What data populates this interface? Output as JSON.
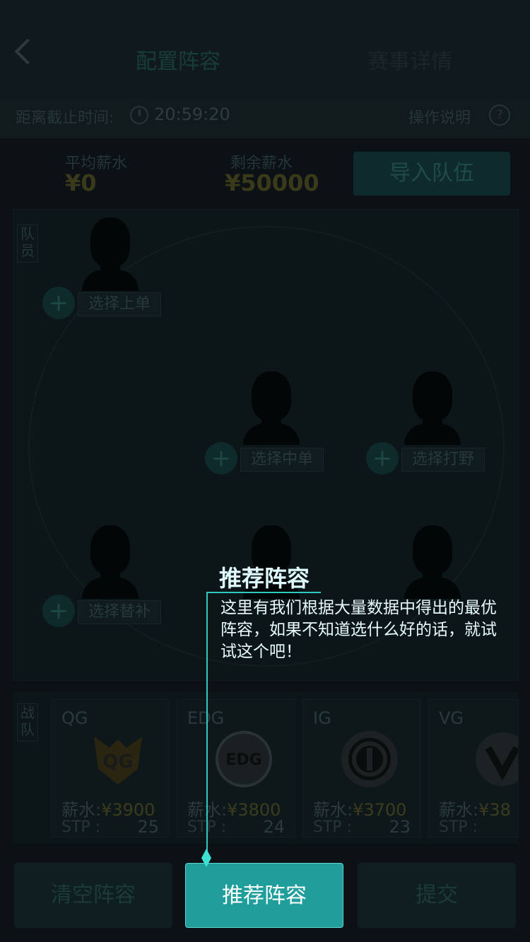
{
  "header": {
    "back_icon": "chevron-left-icon",
    "tab_active": "配置阵容",
    "tab_inactive": "赛事详情"
  },
  "deadline": {
    "label": "距离截止时间:",
    "time": "20:59:20",
    "help_label": "操作说明",
    "help_icon": "?"
  },
  "salary": {
    "avg_label": "平均薪水",
    "avg_value": "¥0",
    "remain_label": "剩余薪水",
    "remain_value": "¥50000",
    "import_button": "导入队伍"
  },
  "players": {
    "side_label": "队员",
    "slots": [
      {
        "label": "选择上单"
      },
      {
        "label": "选择中单"
      },
      {
        "label": "选择打野"
      },
      {
        "label": "选择替补"
      }
    ],
    "plus": "+"
  },
  "teams": {
    "side_label": "战队",
    "salary_prefix": "薪水:",
    "stp_prefix": "STP :",
    "items": [
      {
        "name": "QG",
        "salary": "¥3900",
        "stp": "25"
      },
      {
        "name": "EDG",
        "salary": "¥3800",
        "stp": "24"
      },
      {
        "name": "IG",
        "salary": "¥3700",
        "stp": "23"
      },
      {
        "name": "VG",
        "salary": "¥38",
        "stp": ""
      }
    ]
  },
  "buttons": {
    "clear": "清空阵容",
    "recommend": "推荐阵容",
    "submit": "提交"
  },
  "tooltip": {
    "title": "推荐阵容",
    "text": "这里有我们根据大量数据中得出的最优阵容，如果不知道选什么好的话，就试试这个吧！"
  },
  "colors": {
    "accent": "#1f9e9b",
    "tooltip_line": "#2ec9c0",
    "salary_gold": "#c9c84a"
  }
}
